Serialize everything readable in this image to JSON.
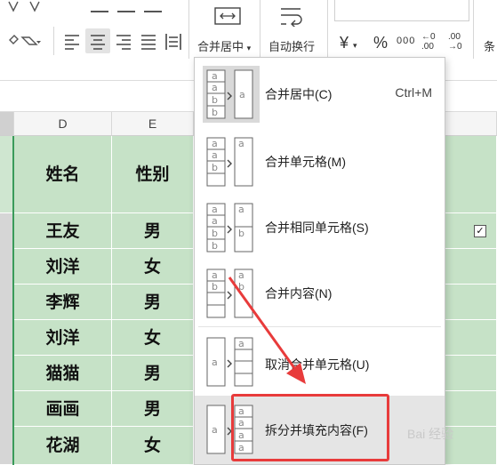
{
  "ribbon": {
    "merge_center_label": "合并居中",
    "wrap_text_label": "自动换行",
    "currency_symbol": "¥",
    "percent_symbol": "%",
    "thousands_symbol": "000",
    "decrease_decimal": "←0 .00",
    "increase_decimal": ".00 →0",
    "conditional_label": "条"
  },
  "columns": [
    {
      "letter": "D"
    },
    {
      "letter": "E"
    }
  ],
  "table": {
    "headers": [
      "姓名",
      "性别"
    ],
    "rows": [
      [
        "王友",
        "男"
      ],
      [
        "刘洋",
        "女"
      ],
      [
        "李辉",
        "男"
      ],
      [
        "刘洋",
        "女"
      ],
      [
        "猫猫",
        "男"
      ],
      [
        "画画",
        "男"
      ],
      [
        "花湖",
        "女"
      ]
    ]
  },
  "menu": {
    "items": [
      {
        "label": "合并居中(C)",
        "shortcut": "Ctrl+M"
      },
      {
        "label": "合并单元格(M)",
        "shortcut": ""
      },
      {
        "label": "合并相同单元格(S)",
        "shortcut": ""
      },
      {
        "label": "合并内容(N)",
        "shortcut": ""
      },
      {
        "label": "取消合并单元格(U)",
        "shortcut": ""
      },
      {
        "label": "拆分并填充内容(F)",
        "shortcut": ""
      }
    ]
  },
  "icon_letters": {
    "a": "a",
    "b": "b"
  },
  "colors": {
    "cell_fill": "#c6e2c7",
    "selection_border": "#3a9b5a",
    "annotation": "#e83b3b"
  },
  "watermark": "Bai 经验"
}
